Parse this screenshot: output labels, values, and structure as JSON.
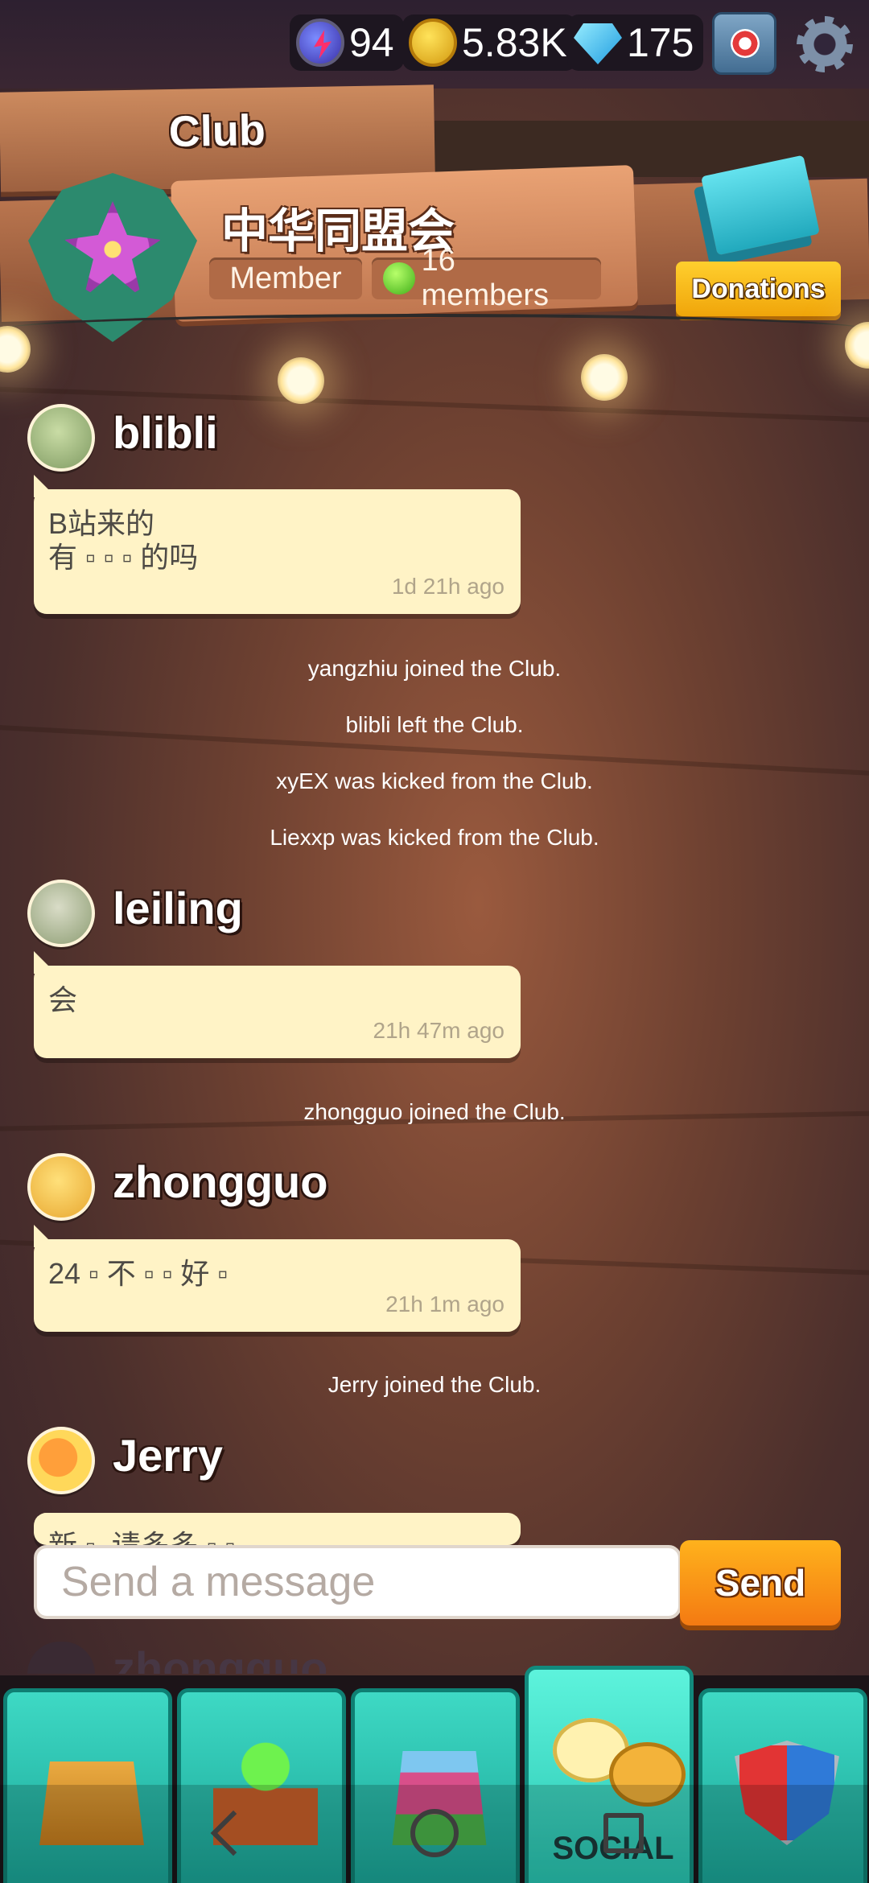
{
  "topbar": {
    "energy": {
      "icon": "energy-icon",
      "value": "94"
    },
    "coins": {
      "icon": "coin-icon",
      "value": "5.83K"
    },
    "gems": {
      "icon": "gem-icon",
      "value": "175"
    },
    "gift_icon": "gift-box-icon",
    "settings_icon": "gear-icon"
  },
  "club": {
    "title": "Club",
    "name": "中华同盟会",
    "role": "Member",
    "members": "16 members",
    "donations_label": "Donations"
  },
  "chat": {
    "messages": [
      {
        "user": "blibli",
        "text": "B站来的\n有 ▫ ▫ ▫ 的吗",
        "time": "1d 21h ago"
      },
      {
        "user": "leiling",
        "text": "会",
        "time": "21h 47m ago"
      },
      {
        "user": "zhongguo",
        "text": "24 ▫ 不 ▫ ▫ 好 ▫",
        "time": "21h 1m ago"
      },
      {
        "user": "Jerry",
        "text": "新 ▫  请多多 ▫ ▫",
        "time": ""
      }
    ],
    "system": [
      "yangzhiu joined the Club.",
      "blibli left the Club.",
      "xyEX was kicked from the Club.",
      "Liexxp was kicked from the Club.",
      "zhongguo joined the Club.",
      "Jerry joined the Club."
    ],
    "partial_user": "zhongguo"
  },
  "composer": {
    "placeholder": "Send a message",
    "send_label": "Send"
  },
  "nav": {
    "tabs": [
      "shop",
      "plants",
      "town",
      "social",
      "arena"
    ],
    "active_label": "SOCIAL"
  },
  "colors": {
    "accent": "#2bc6b2",
    "send": "#f58f16",
    "bubble": "#fff3c6"
  }
}
